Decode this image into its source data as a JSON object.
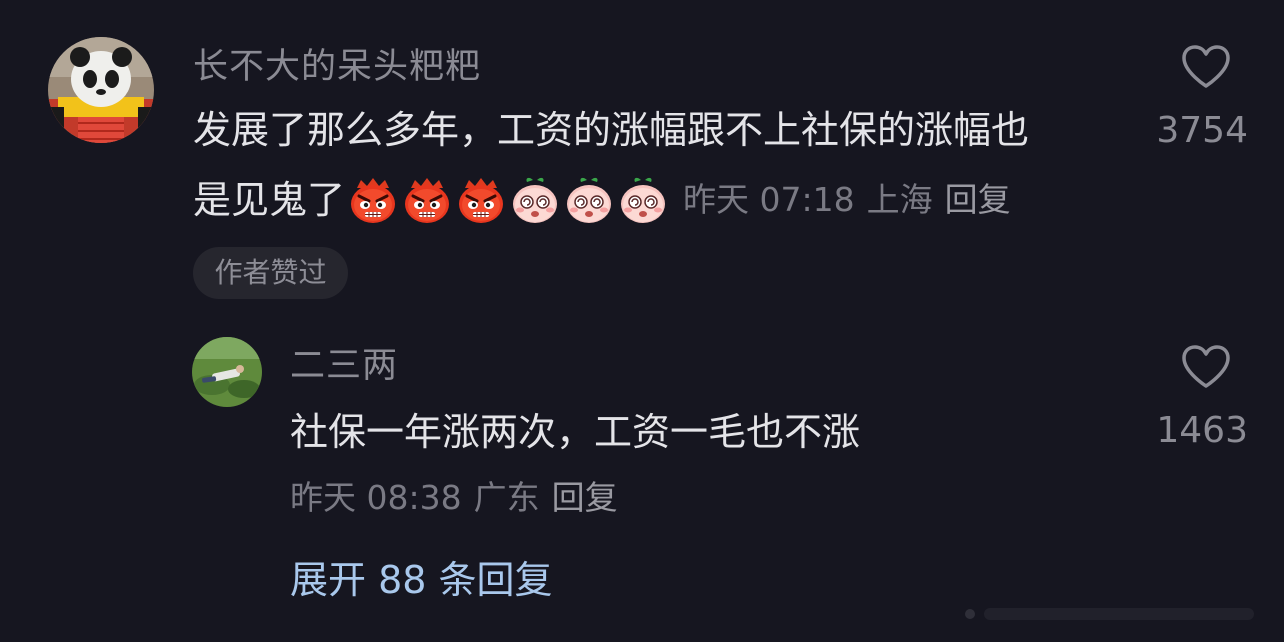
{
  "comment": {
    "username": "长不大的呆头粑粑",
    "text_line1": "发展了那么多年，工资的涨幅跟不上社保的涨幅也",
    "text_line2": "是见鬼了",
    "emojis": [
      "angry-face-emoji",
      "angry-face-emoji",
      "angry-face-emoji",
      "dizzy-face-emoji",
      "dizzy-face-emoji",
      "dizzy-face-emoji"
    ],
    "time": "昨天 07:18",
    "location": "上海",
    "reply_label": "回复",
    "author_liked_label": "作者赞过",
    "like_count": "3754"
  },
  "reply": {
    "username": "二三两",
    "text": "社保一年涨两次，工资一毛也不涨",
    "time": "昨天 08:38",
    "location": "广东",
    "reply_label": "回复",
    "like_count": "1463"
  },
  "expand": {
    "label": "展开 88 条回复"
  },
  "colors": {
    "background": "#161620",
    "text_primary": "#e4e4e8",
    "text_secondary": "#8b8b94",
    "link": "#a9c8ec",
    "pill": "#26262e"
  }
}
